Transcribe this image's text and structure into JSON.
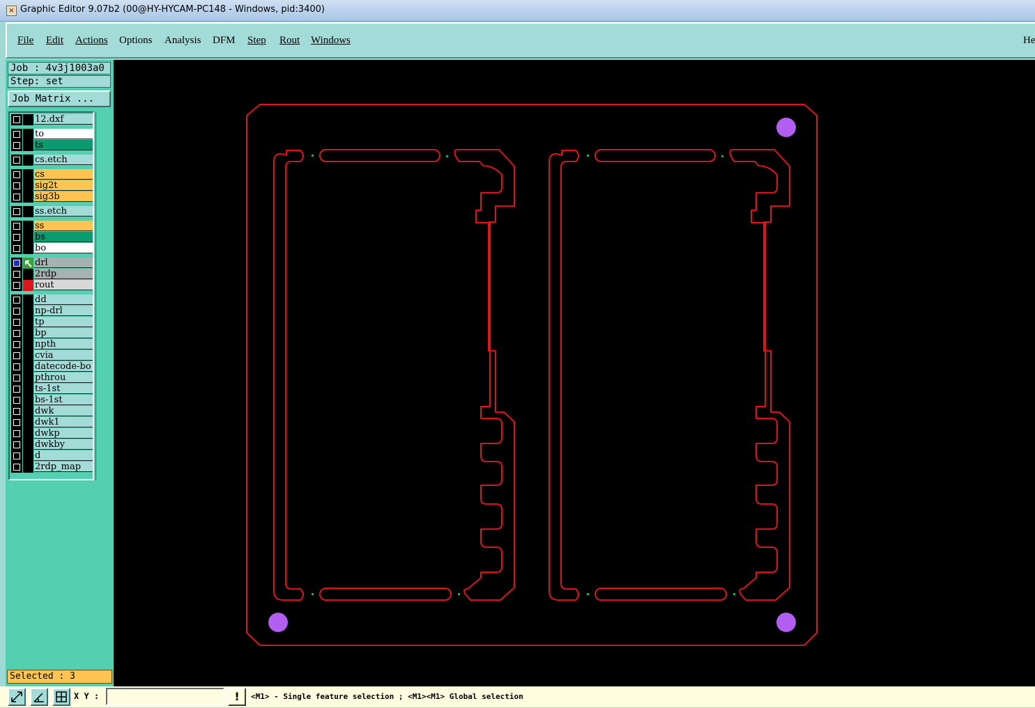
{
  "window": {
    "title": "Graphic Editor 9.07b2 (00@HY-HYCAM-PC148 - Windows, pid:3400)",
    "icon": "app-x-icon"
  },
  "menu": {
    "items": [
      {
        "label": "File"
      },
      {
        "label": "Edit"
      },
      {
        "label": "Actions"
      },
      {
        "label": "Options"
      },
      {
        "label": "Analysis"
      },
      {
        "label": "DFM"
      },
      {
        "label": "Step"
      },
      {
        "label": "Rout"
      },
      {
        "label": "Windows"
      }
    ],
    "help_label": "He"
  },
  "panel": {
    "job_line": "Job : 4v3j1003a0",
    "step_line": "Step: set",
    "job_matrix_label": "Job Matrix ...",
    "selected_label": "Selected : 3"
  },
  "layers": [
    {
      "name": "12.dxf",
      "color": "#a3dbd8"
    },
    {
      "name": "to",
      "color": "#ffffff"
    },
    {
      "name": "ts",
      "color": "#0a9a6e"
    },
    {
      "name": "cs.etch",
      "color": "#a3dbd8"
    },
    {
      "name": "cs",
      "color": "#fec452"
    },
    {
      "name": "sig2t",
      "color": "#fec452"
    },
    {
      "name": "sig3b",
      "color": "#fec452"
    },
    {
      "name": "ss.etch",
      "color": "#a3dbd8"
    },
    {
      "name": "ss",
      "color": "#fec452"
    },
    {
      "name": "bs",
      "color": "#0a9a6e"
    },
    {
      "name": "bo",
      "color": "#ffffff"
    },
    {
      "name": "drl",
      "color": "#a6b2b2",
      "work": true
    },
    {
      "name": "2rdp",
      "color": "#a6b2b2"
    },
    {
      "name": "rout",
      "color": "#d8d8d8",
      "display": true
    },
    {
      "name": "dd",
      "color": "#a3dbd8"
    },
    {
      "name": "np-drl",
      "color": "#a3dbd8"
    },
    {
      "name": "tp",
      "color": "#a3dbd8"
    },
    {
      "name": "bp",
      "color": "#a3dbd8"
    },
    {
      "name": "npth",
      "color": "#a3dbd8"
    },
    {
      "name": "cvia",
      "color": "#a3dbd8"
    },
    {
      "name": "datecode-bo",
      "color": "#a3dbd8"
    },
    {
      "name": "pthrou",
      "color": "#a3dbd8"
    },
    {
      "name": "ts-1st",
      "color": "#a3dbd8"
    },
    {
      "name": "bs-1st",
      "color": "#a3dbd8"
    },
    {
      "name": "dwk",
      "color": "#a3dbd8"
    },
    {
      "name": "dwk1",
      "color": "#a3dbd8"
    },
    {
      "name": "dwkp",
      "color": "#a3dbd8"
    },
    {
      "name": "dwkby",
      "color": "#a3dbd8"
    },
    {
      "name": "d",
      "color": "#a3dbd8"
    },
    {
      "name": "2rdp_map",
      "color": "#a3dbd8"
    }
  ],
  "bottom": {
    "xy_label": "X Y :",
    "coord_value": "",
    "warn_label": "!",
    "status_message": "<M1> - Single feature selection ; <M1><M1> Global selection"
  },
  "colors": {
    "rout_line": "#e0141e",
    "pad": "#b25ef0",
    "canvas": "#000000"
  }
}
